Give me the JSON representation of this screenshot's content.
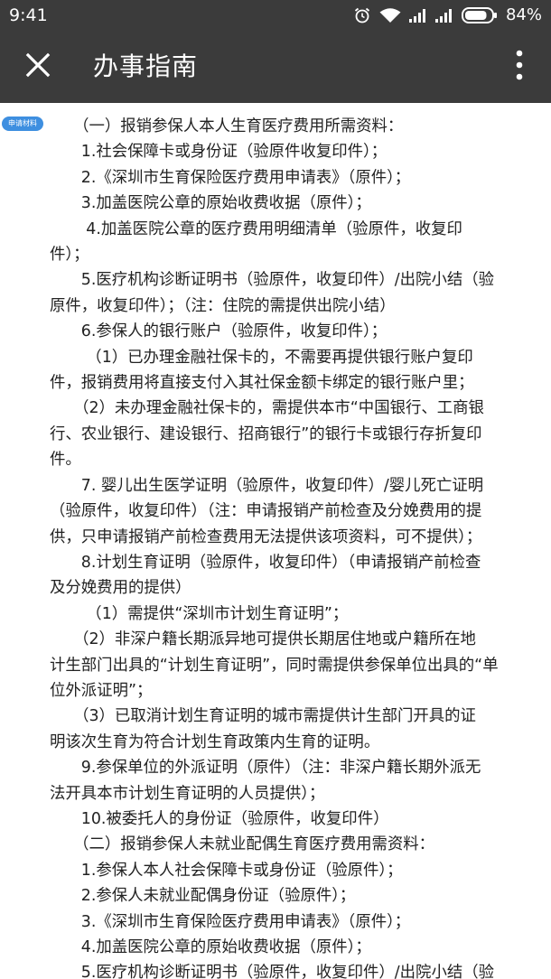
{
  "status_bar": {
    "time": "9:41",
    "battery_percent": "84%",
    "icons": [
      "alarm-icon",
      "wifi-icon",
      "signal-icon",
      "signal-icon",
      "battery-icon"
    ],
    "battery_level": 0.84
  },
  "app_bar": {
    "title": "办事指南",
    "close_icon": "close-icon",
    "more_icon": "more-vert-icon"
  },
  "content": {
    "badge": "申请材料",
    "lines": [
      "　　（一）报销参保人本人生育医疗费用所需资料：",
      "　　1.社会保障卡或身份证（验原件收复印件）；",
      "　　2.《深圳市生育保险医疗费用申请表》（原件）；",
      "　　3.加盖医院公章的原始收费收据（原件）；",
      "　　 4.加盖医院公章的医疗费用明细清单（验原件，收复印",
      "件）；",
      "　　5.医疗机构诊断证明书（验原件，收复印件）/出院小结（验",
      "原件，收复印件）；（注：住院的需提供出院小结）",
      "　　6.参保人的银行账户（验原件，收复印件）；",
      "　　 （1）已办理金融社保卡的，不需要再提供银行账户复印",
      "件，报销费用将直接支付入其社保金额卡绑定的银行账户里；",
      "　　（2）未办理金融社保卡的，需提供本市“中国银行、工商银",
      "行、农业银行、建设银行、招商银行”的银行卡或银行存折复印",
      "件。",
      "　　7. 婴儿出生医学证明（验原件，收复印件）/婴儿死亡证明",
      "（验原件，收复印件）（注：申请报销产前检查及分娩费用的提",
      "供，只申请报销产前检查费用无法提供该项资料，可不提供）；",
      "　　8.计划生育证明（验原件，收复印件）（申请报销产前检查",
      "及分娩费用的提供）",
      "　　 （1）需提供“深圳市计划生育证明”；",
      "　　（2）非深户籍长期派异地可提供长期居住地或户籍所在地",
      "计生部门出具的“计划生育证明”，同时需提供参保单位出具的“单",
      "位外派证明”；",
      "　　（3）已取消计划生育证明的城市需提供计生部门开具的证",
      "明该次生育为符合计划生育政策内生育的证明。",
      "　　9.参保单位的外派证明（原件）（注：非深户籍长期外派无",
      "法开具本市计划生育证明的人员提供）；",
      "　　10.被委托人的身份证（验原件，收复印件）",
      "　　（二）报销参保人未就业配偶生育医疗费用需资料：",
      "　　1.参保人本人社会保障卡或身份证（验原件）；",
      "　　2.参保人未就业配偶身份证（验原件）；",
      "　　3.《深圳市生育保险医疗费用申请表》（原件）；",
      "　　4.加盖医院公章的原始收费收据（原件）；",
      "　　5.医疗机构诊断证明书（验原件，收复印件）/出院小结（验"
    ]
  }
}
